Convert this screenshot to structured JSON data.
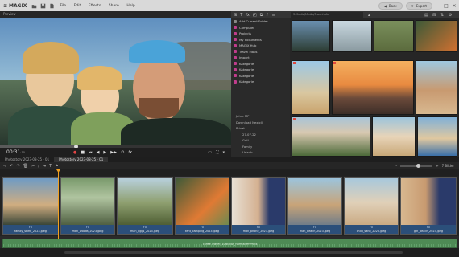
{
  "app": {
    "brand": "MAGIX",
    "menu": [
      "File",
      "Edit",
      "Effects",
      "Share",
      "Help"
    ],
    "back_label": "Back",
    "export_label": "Export"
  },
  "preview": {
    "title": "Preview",
    "time": "00:31",
    "time_frames": ":10"
  },
  "media": {
    "path": "3.Media/Media/Fraunhofer",
    "folders": [
      {
        "label": "Add Current Folder",
        "color": "#888888"
      },
      {
        "label": "Computer",
        "color": "#c03c8c"
      },
      {
        "label": "Projects",
        "color": "#c03c8c"
      },
      {
        "label": "My documents",
        "color": "#c03c8c"
      },
      {
        "label": "MAGIX Hub",
        "color": "#c03c8c"
      },
      {
        "label": "Travel Maps",
        "color": "#c03c8c"
      },
      {
        "label": "Importi",
        "color": "#c03c8c"
      },
      {
        "label": "Kategorie",
        "color": "#c03c8c"
      },
      {
        "label": "Kategorie",
        "color": "#c03c8c"
      },
      {
        "label": "Kategorie",
        "color": "#c03c8c"
      },
      {
        "label": "Kategorie",
        "color": "#c03c8c"
      }
    ],
    "tree": [
      {
        "label": "Jahre MP",
        "sub": false
      },
      {
        "label": "Download Nextclli",
        "sub": false
      },
      {
        "label": "Privat",
        "sub": false
      },
      {
        "label": "27.07.22",
        "sub": true
      },
      {
        "label": "Grill",
        "sub": true
      },
      {
        "label": "Family",
        "sub": true
      },
      {
        "label": "Urlaub",
        "sub": true
      }
    ]
  },
  "project": {
    "tabs": [
      "Photostory 2023-08-25 - 01",
      "Photostory 2023-08-25 - 01"
    ],
    "zoom_label": "7 Bilder"
  },
  "timeline": {
    "clips": [
      {
        "file": "family_selfie_2023.jpeg",
        "fx": "FX"
      },
      {
        "file": "man_woods_2023.jpeg",
        "fx": "FX"
      },
      {
        "file": "man_eggs_2023.jpeg",
        "fx": "FX"
      },
      {
        "file": "tent_camping_2023.jpeg",
        "fx": "FX"
      },
      {
        "file": "man_phone_2023.jpeg",
        "fx": "FX"
      },
      {
        "file": "man_beach_2023.jpeg",
        "fx": "FX"
      },
      {
        "file": "child_sand_2023.jpeg",
        "fx": "FX"
      },
      {
        "file": "girl_beach_2023.jpeg",
        "fx": "FX"
      }
    ],
    "audio": "Three Travel_1080BIA_normal.mvmp4"
  }
}
